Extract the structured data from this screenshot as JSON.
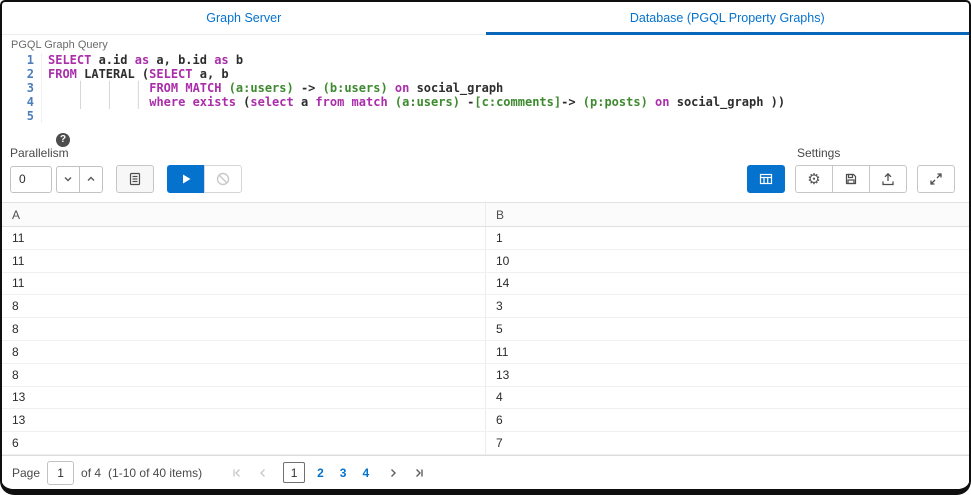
{
  "tabs": {
    "graph_server": "Graph Server",
    "database": "Database (PGQL Property Graphs)"
  },
  "editor": {
    "label": "PGQL Graph Query",
    "lines": [
      {
        "n": "1",
        "tokens": [
          {
            "c": "k",
            "t": "SELECT"
          },
          {
            "c": "p",
            "t": " a.id "
          },
          {
            "c": "k",
            "t": "as"
          },
          {
            "c": "p",
            "t": " a, b.id "
          },
          {
            "c": "k",
            "t": "as"
          },
          {
            "c": "p",
            "t": " b"
          }
        ]
      },
      {
        "n": "2",
        "tokens": [
          {
            "c": "k",
            "t": "FROM"
          },
          {
            "c": "p",
            "t": " LATERAL ("
          },
          {
            "c": "k",
            "t": "SELECT"
          },
          {
            "c": "p",
            "t": " a, b"
          }
        ]
      },
      {
        "n": "3",
        "tokens": [
          {
            "c": "p",
            "t": "    "
          },
          {
            "c": "gd",
            "t": "│"
          },
          {
            "c": "p",
            "t": "   "
          },
          {
            "c": "gd",
            "t": "│"
          },
          {
            "c": "p",
            "t": "   "
          },
          {
            "c": "gd",
            "t": "│"
          },
          {
            "c": "p",
            "t": " "
          },
          {
            "c": "k",
            "t": "FROM MATCH"
          },
          {
            "c": "p",
            "t": " "
          },
          {
            "c": "g",
            "t": "(a:users)"
          },
          {
            "c": "p",
            "t": " -> "
          },
          {
            "c": "g",
            "t": "(b:users)"
          },
          {
            "c": "p",
            "t": " "
          },
          {
            "c": "k",
            "t": "on"
          },
          {
            "c": "p",
            "t": " social_graph"
          }
        ]
      },
      {
        "n": "4",
        "tokens": [
          {
            "c": "p",
            "t": "    "
          },
          {
            "c": "gd",
            "t": "│"
          },
          {
            "c": "p",
            "t": "   "
          },
          {
            "c": "gd",
            "t": "│"
          },
          {
            "c": "p",
            "t": "   "
          },
          {
            "c": "gd",
            "t": "│"
          },
          {
            "c": "p",
            "t": " "
          },
          {
            "c": "k",
            "t": "where exists"
          },
          {
            "c": "p",
            "t": " ("
          },
          {
            "c": "k",
            "t": "select"
          },
          {
            "c": "p",
            "t": " a "
          },
          {
            "c": "k",
            "t": "from match"
          },
          {
            "c": "p",
            "t": " "
          },
          {
            "c": "g",
            "t": "(a:users)"
          },
          {
            "c": "p",
            "t": " -"
          },
          {
            "c": "g",
            "t": "[c:comments]"
          },
          {
            "c": "p",
            "t": "-> "
          },
          {
            "c": "g",
            "t": "(p:posts)"
          },
          {
            "c": "p",
            "t": " "
          },
          {
            "c": "k",
            "t": "on"
          },
          {
            "c": "p",
            "t": " social_graph ))"
          }
        ]
      },
      {
        "n": "5",
        "tokens": []
      }
    ]
  },
  "toolbar": {
    "parallelism_label": "Parallelism",
    "parallelism_value": "0",
    "settings_label": "Settings"
  },
  "icons": {
    "help_glyph": "?",
    "gear_glyph": "⚙"
  },
  "table": {
    "columns": [
      "A",
      "B"
    ],
    "rows": [
      [
        "11",
        "1"
      ],
      [
        "11",
        "10"
      ],
      [
        "11",
        "14"
      ],
      [
        "8",
        "3"
      ],
      [
        "8",
        "5"
      ],
      [
        "8",
        "11"
      ],
      [
        "8",
        "13"
      ],
      [
        "13",
        "4"
      ],
      [
        "13",
        "6"
      ],
      [
        "6",
        "7"
      ]
    ]
  },
  "pagination": {
    "page_label": "Page",
    "page_value": "1",
    "of_label": "of 4",
    "items_label": "(1-10 of 40 items)",
    "pages": [
      {
        "label": "1",
        "current": true
      },
      {
        "label": "2",
        "current": false
      },
      {
        "label": "3",
        "current": false
      },
      {
        "label": "4",
        "current": false
      }
    ]
  },
  "colors": {
    "accent_blue": "#0572ce",
    "keyword_magenta": "#aa2daa",
    "pattern_green": "#3d8a2f",
    "gutter_blue": "#4d7ebb"
  }
}
